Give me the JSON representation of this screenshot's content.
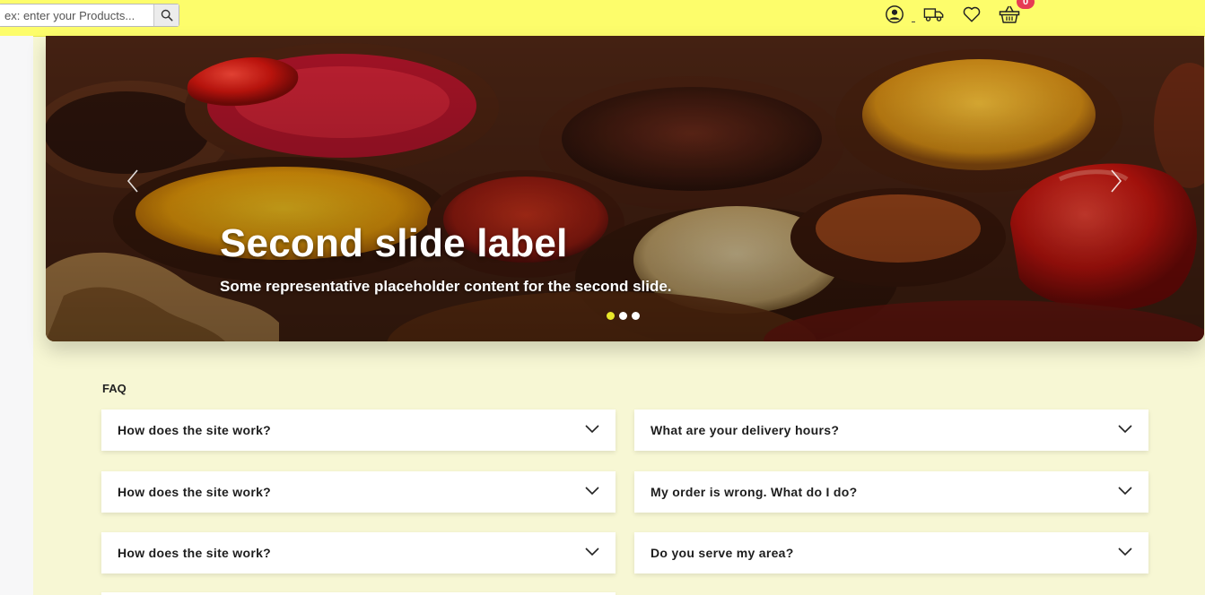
{
  "header": {
    "search_placeholder": "ex: enter your Products...",
    "icons": [
      "search-icon",
      "user-icon",
      "truck-icon",
      "heart-icon",
      "basket-icon"
    ],
    "cart_count": "0",
    "colors": {
      "bar": "#fdfd6b",
      "badge": "#e63b54"
    }
  },
  "carousel": {
    "title": "Second slide label",
    "text": "Some representative placeholder content for the second slide.",
    "slide_count": 3,
    "active_index": 0,
    "prev_icon": "chevron-left-icon",
    "next_icon": "chevron-right-icon"
  },
  "faq": {
    "label": "FAQ",
    "left": [
      "How does the site work?",
      "How does the site work?",
      "How does the site work?"
    ],
    "right": [
      "What are your delivery hours?",
      "My order is wrong. What do I do?",
      "Do you serve my area?"
    ],
    "chevron_icon": "chevron-down-icon"
  }
}
